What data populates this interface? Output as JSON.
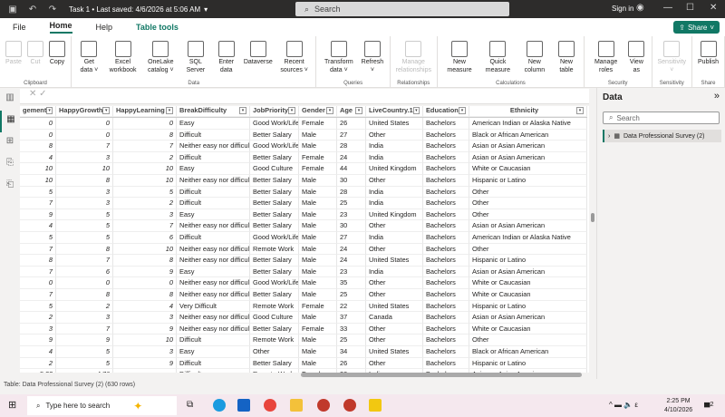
{
  "titlebar": {
    "title": "Task 1 • Last saved: 4/6/2026 at 5:06 AM",
    "search": "Search",
    "sign_in": "Sign in"
  },
  "tabs": [
    "File",
    "Home",
    "Help",
    "Table tools"
  ],
  "share": "Share",
  "ribbon": [
    {
      "label": "Clipboard",
      "buttons": [
        {
          "l": "Paste",
          "dis": true
        },
        {
          "l": "Cut",
          "dis": true
        },
        {
          "l": "Copy"
        }
      ]
    },
    {
      "label": "Data",
      "buttons": [
        {
          "l": "Get data ˅"
        },
        {
          "l": "Excel workbook"
        },
        {
          "l": "OneLake catalog ˅"
        },
        {
          "l": "SQL Server"
        },
        {
          "l": "Enter data"
        },
        {
          "l": "Dataverse"
        },
        {
          "l": "Recent sources ˅"
        }
      ]
    },
    {
      "label": "Queries",
      "buttons": [
        {
          "l": "Transform data ˅"
        },
        {
          "l": "Refresh ˅"
        }
      ]
    },
    {
      "label": "Relationships",
      "buttons": [
        {
          "l": "Manage relationships",
          "dis": true
        }
      ]
    },
    {
      "label": "Calculations",
      "buttons": [
        {
          "l": "New measure"
        },
        {
          "l": "Quick measure"
        },
        {
          "l": "New column"
        },
        {
          "l": "New table"
        }
      ]
    },
    {
      "label": "Security",
      "buttons": [
        {
          "l": "Manage roles"
        },
        {
          "l": "View as"
        }
      ]
    },
    {
      "label": "Sensitivity",
      "buttons": [
        {
          "l": "Sensitivity ˅",
          "dis": true
        }
      ]
    },
    {
      "label": "Share",
      "buttons": [
        {
          "l": "Publish"
        }
      ]
    }
  ],
  "table": {
    "columns": [
      "gement",
      "HappyGrowth",
      "HappyLearning",
      "BreakDifficulty",
      "JobPriority",
      "Gender",
      "Age",
      "LiveCountry.1",
      "Education",
      "Ethnicity"
    ],
    "rows": [
      [
        "0",
        "0",
        "0",
        "Easy",
        "Good Work/Life",
        "Female",
        "26",
        "United States",
        "Bachelors",
        "American Indian or Alaska Native"
      ],
      [
        "0",
        "0",
        "8",
        "Difficult",
        "Better Salary",
        "Male",
        "27",
        "Other",
        "Bachelors",
        "Black or African American"
      ],
      [
        "8",
        "7",
        "7",
        "Neither easy nor difficult",
        "Good Work/Life",
        "Male",
        "28",
        "India",
        "Bachelors",
        "Asian or Asian American"
      ],
      [
        "4",
        "3",
        "2",
        "Difficult",
        "Better Salary",
        "Female",
        "24",
        "India",
        "Bachelors",
        "Asian or Asian American"
      ],
      [
        "10",
        "10",
        "10",
        "Easy",
        "Good Culture",
        "Female",
        "44",
        "United Kingdom",
        "Bachelors",
        "White or Caucasian"
      ],
      [
        "10",
        "8",
        "10",
        "Neither easy nor difficult",
        "Better Salary",
        "Male",
        "30",
        "Other",
        "Bachelors",
        "Hispanic or Latino"
      ],
      [
        "5",
        "3",
        "5",
        "Difficult",
        "Better Salary",
        "Male",
        "28",
        "India",
        "Bachelors",
        "Other"
      ],
      [
        "7",
        "3",
        "2",
        "Difficult",
        "Better Salary",
        "Male",
        "25",
        "India",
        "Bachelors",
        "Other"
      ],
      [
        "9",
        "5",
        "3",
        "Easy",
        "Better Salary",
        "Male",
        "23",
        "United Kingdom",
        "Bachelors",
        "Other"
      ],
      [
        "4",
        "5",
        "7",
        "Neither easy nor difficult",
        "Better Salary",
        "Male",
        "30",
        "Other",
        "Bachelors",
        "Asian or Asian American"
      ],
      [
        "5",
        "5",
        "6",
        "Difficult",
        "Good Work/Life",
        "Male",
        "27",
        "India",
        "Bachelors",
        "American Indian or Alaska Native"
      ],
      [
        "7",
        "8",
        "10",
        "Neither easy nor difficult",
        "Remote Work",
        "Male",
        "24",
        "Other",
        "Bachelors",
        "Other"
      ],
      [
        "8",
        "7",
        "8",
        "Neither easy nor difficult",
        "Better Salary",
        "Male",
        "24",
        "United States",
        "Bachelors",
        "Hispanic or Latino"
      ],
      [
        "7",
        "6",
        "9",
        "Easy",
        "Better Salary",
        "Male",
        "23",
        "India",
        "Bachelors",
        "Asian or Asian American"
      ],
      [
        "0",
        "0",
        "0",
        "Neither easy nor difficult",
        "Good Work/Life",
        "Male",
        "35",
        "Other",
        "Bachelors",
        "White or Caucasian"
      ],
      [
        "7",
        "8",
        "8",
        "Neither easy nor difficult",
        "Better Salary",
        "Male",
        "25",
        "Other",
        "Bachelors",
        "White or Caucasian"
      ],
      [
        "5",
        "2",
        "4",
        "Very Difficult",
        "Remote Work",
        "Female",
        "22",
        "United States",
        "Bachelors",
        "Hispanic or Latino"
      ],
      [
        "2",
        "3",
        "3",
        "Neither easy nor difficult",
        "Good Culture",
        "Male",
        "37",
        "Canada",
        "Bachelors",
        "Asian or Asian American"
      ],
      [
        "3",
        "7",
        "9",
        "Neither easy nor difficult",
        "Better Salary",
        "Female",
        "33",
        "Other",
        "Bachelors",
        "White or Caucasian"
      ],
      [
        "9",
        "9",
        "10",
        "Difficult",
        "Remote Work",
        "Male",
        "25",
        "Other",
        "Bachelors",
        "Other"
      ],
      [
        "4",
        "5",
        "3",
        "Easy",
        "Other",
        "Male",
        "34",
        "United States",
        "Bachelors",
        "Black or African American"
      ],
      [
        "2",
        "5",
        "9",
        "Difficult",
        "Better Salary",
        "Male",
        "26",
        "Other",
        "Bachelors",
        "Hispanic or Latino"
      ],
      [
        "5.33",
        "4.76",
        "",
        "Difficult",
        "Remote Work",
        "Female",
        "20",
        "India",
        "Bachelors",
        "Asian or Asian American"
      ]
    ]
  },
  "status": "Table: Data Professional Survey (2) (630 rows)",
  "pane": {
    "title": "Data",
    "search_placeholder": "Search",
    "table_name": "Data Professional Survey (2)"
  },
  "taskbar": {
    "search_placeholder": "Type here to search",
    "time": "2:25 PM",
    "date": "4/10/2026",
    "notifications": "2"
  },
  "colors": {
    "accent": "#117865",
    "titlebar": "#2d2c2b"
  }
}
